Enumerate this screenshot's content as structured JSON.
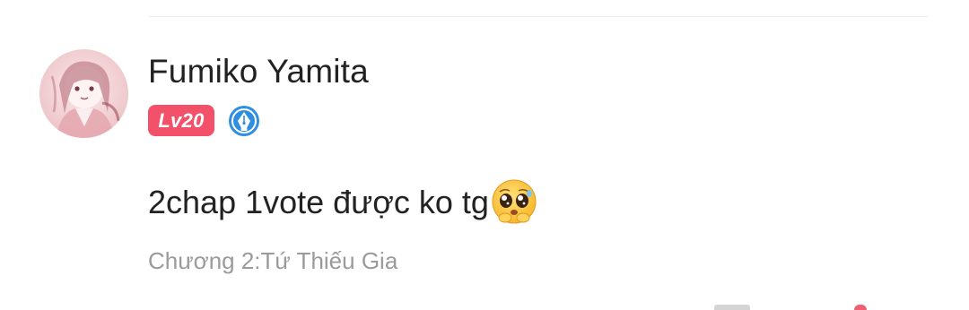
{
  "comment": {
    "author": "Fumiko Yamita",
    "level": "Lv20",
    "text": "2chap 1vote được ko tg",
    "emoji": "pleading-face-emoji",
    "chapter": "Chương 2:Tứ Thiếu Gia"
  },
  "colors": {
    "level_badge": "#f3506a",
    "pen_badge": "#2f8fde",
    "chapter_text": "#9a9a9a"
  }
}
